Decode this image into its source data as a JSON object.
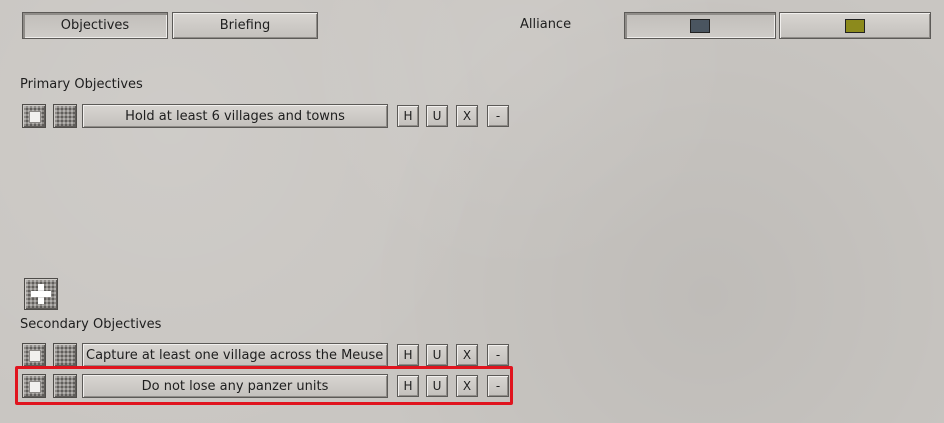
{
  "tabs": {
    "objectives_label": "Objectives",
    "briefing_label": "Briefing"
  },
  "alliance": {
    "label": "Alliance",
    "swatch_1_color": "#4a5560",
    "swatch_2_color": "#8c8a1c"
  },
  "primary": {
    "heading": "Primary Objectives",
    "items": [
      {
        "label": "Hold at least 6 villages and towns"
      }
    ]
  },
  "secondary": {
    "heading": "Secondary Objectives",
    "items": [
      {
        "label": "Capture at least one village across the Meuse River"
      },
      {
        "label": "Do not lose any panzer units"
      }
    ]
  },
  "row_buttons": {
    "h": "H",
    "u": "U",
    "x": "X",
    "remove": "-"
  },
  "colors": {
    "highlight": "#e0141e"
  }
}
